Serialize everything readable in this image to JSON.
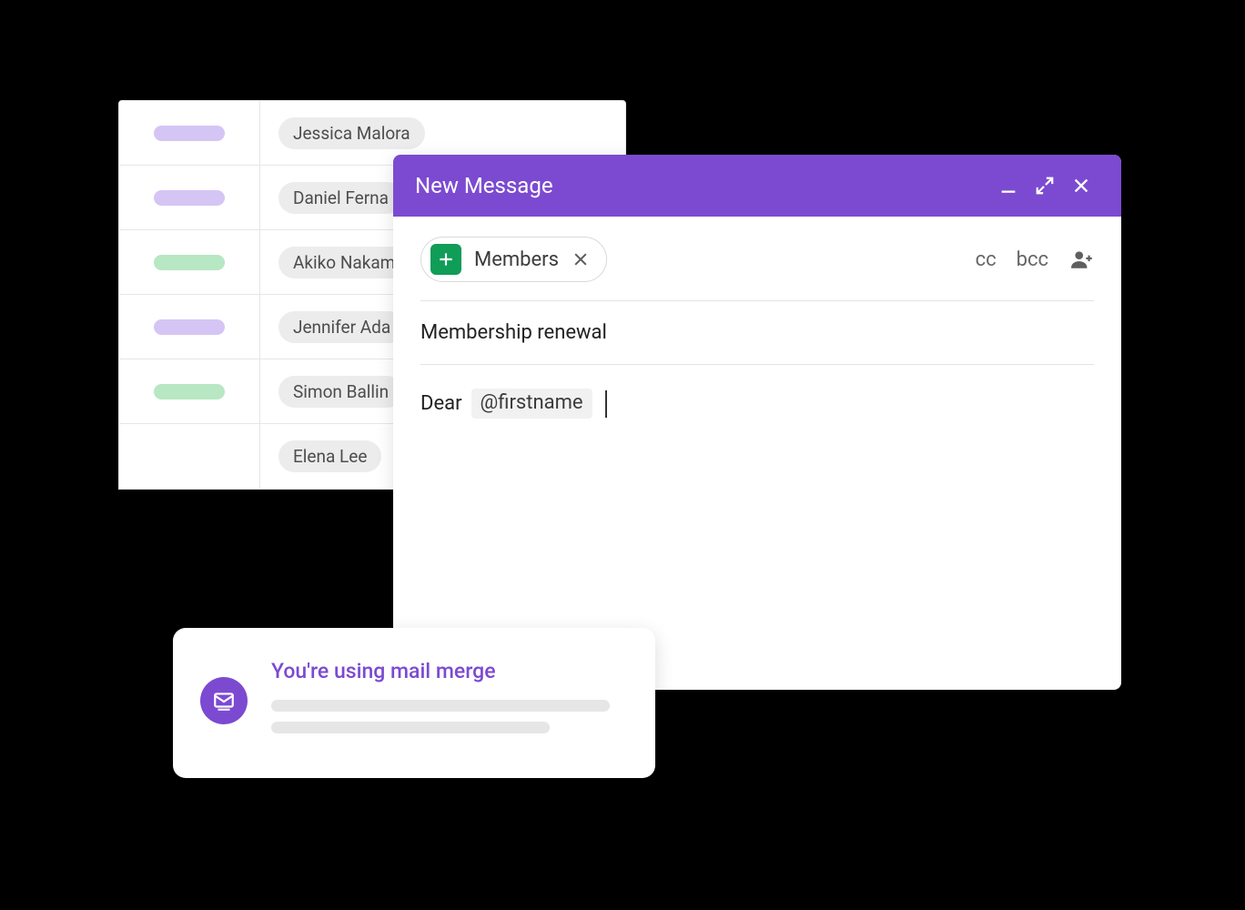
{
  "sheet": {
    "rows": [
      {
        "color": "purple",
        "name": "Jessica Malora"
      },
      {
        "color": "purple",
        "name": "Daniel Ferna"
      },
      {
        "color": "green",
        "name": "Akiko Nakam"
      },
      {
        "color": "purple",
        "name": "Jennifer Ada"
      },
      {
        "color": "green",
        "name": "Simon Ballin"
      },
      {
        "color": "",
        "name": "Elena Lee"
      }
    ]
  },
  "compose": {
    "title": "New Message",
    "recipient_chip": "Members",
    "cc": "cc",
    "bcc": "bcc",
    "subject": "Membership renewal",
    "body_prefix": "Dear",
    "merge_tag": "@firstname"
  },
  "notice": {
    "title": "You're using mail merge"
  }
}
